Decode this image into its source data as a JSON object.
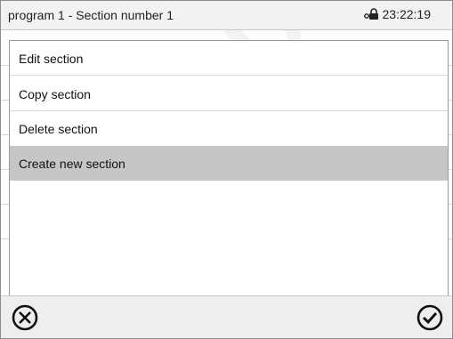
{
  "header": {
    "title": "program 1 - Section number 1",
    "time": "23:22:19",
    "lock_icon": "lock-key-icon"
  },
  "menu": {
    "items": [
      {
        "label": "Edit section",
        "selected": false
      },
      {
        "label": "Copy section",
        "selected": false
      },
      {
        "label": "Delete section",
        "selected": false
      },
      {
        "label": "Create new section",
        "selected": true
      }
    ]
  },
  "footer": {
    "cancel_icon": "cancel-circle-icon",
    "confirm_icon": "confirm-check-circle-icon"
  },
  "watermark": {
    "text": "QUE D"
  },
  "colors": {
    "selected_row": "#c6c6c6",
    "header_bg": "#f2f2f2",
    "footer_bg": "#eeeeee"
  }
}
